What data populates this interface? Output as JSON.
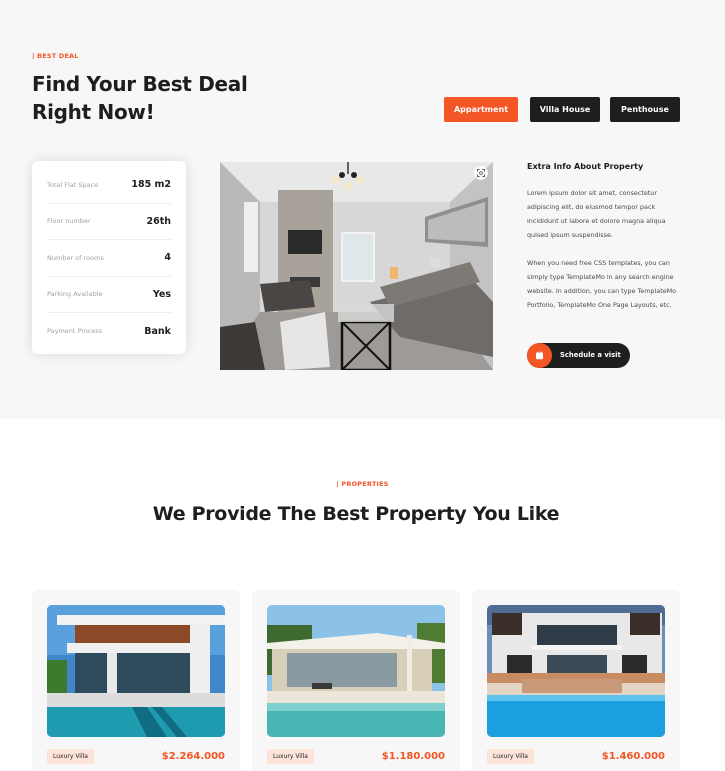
{
  "deal": {
    "eyebrow": "| BEST DEAL",
    "title": "Find Your Best Deal Right Now!",
    "tabs": [
      "Appartment",
      "Villa House",
      "Penthouse"
    ],
    "details": [
      {
        "label": "Total Flat Space",
        "value": "185 m2"
      },
      {
        "label": "Floor number",
        "value": "26th"
      },
      {
        "label": "Number of rooms",
        "value": "4"
      },
      {
        "label": "Parking Available",
        "value": "Yes"
      },
      {
        "label": "Payment Process",
        "value": "Bank"
      }
    ],
    "extra_title": "Extra Info About Property",
    "extra_p1": "Lorem ipsum dolor sit amet, consectetur adipiscing elit, do eiusmod tempor pack incididunt ut labore et dolore magna aliqua quised ipsum suspendisse.",
    "extra_p2": "When you need free CSS templates, you can simply type TemplateMo in any search engine website. In addition, you can type TemplateMo Portfolio, TemplateMo One Page Layouts, etc.",
    "schedule_label": "Schedule a visit"
  },
  "properties": {
    "eyebrow": "| PROPERTIES",
    "title": "We Provide The Best Property You Like",
    "items": [
      {
        "tag": "Luxury Villa",
        "price": "$2.264.000"
      },
      {
        "tag": "Luxury Villa",
        "price": "$1.180.000"
      },
      {
        "tag": "Luxury Villa",
        "price": "$1.460.000"
      }
    ]
  },
  "colors": {
    "accent": "#f35525",
    "dark": "#1e1e1e",
    "section_bg": "#f7f7f7",
    "tag_bg": "#fde3d9"
  },
  "icons": {
    "zoom": "zoom-icon",
    "schedule": "calendar-icon"
  }
}
